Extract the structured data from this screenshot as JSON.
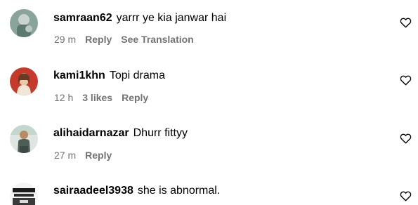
{
  "comments": [
    {
      "username": "samraan62",
      "text": "yarrr ye kia janwar hai",
      "time": "29 m",
      "likes": "",
      "reply_label": "Reply",
      "translate_label": "See Translation",
      "avatar_icon": "user-avatar-icon",
      "like_icon": "heart-outline-icon"
    },
    {
      "username": "kami1khn",
      "text": "Topi drama",
      "time": "12 h",
      "likes": "3 likes",
      "reply_label": "Reply",
      "translate_label": "",
      "avatar_icon": "user-avatar-icon",
      "like_icon": "heart-outline-icon"
    },
    {
      "username": "alihaidarnazar",
      "text": "Dhurr fittyy",
      "time": "27 m",
      "likes": "",
      "reply_label": "Reply",
      "translate_label": "",
      "avatar_icon": "user-avatar-icon",
      "like_icon": "heart-outline-icon"
    },
    {
      "username": "sairaadeel3938",
      "text": "she is abnormal.",
      "avatar_icon": "user-avatar-icon",
      "like_icon": "heart-outline-icon"
    }
  ],
  "colors": {
    "primary_text": "#000000",
    "secondary_text": "#737373",
    "background": "#ffffff"
  }
}
